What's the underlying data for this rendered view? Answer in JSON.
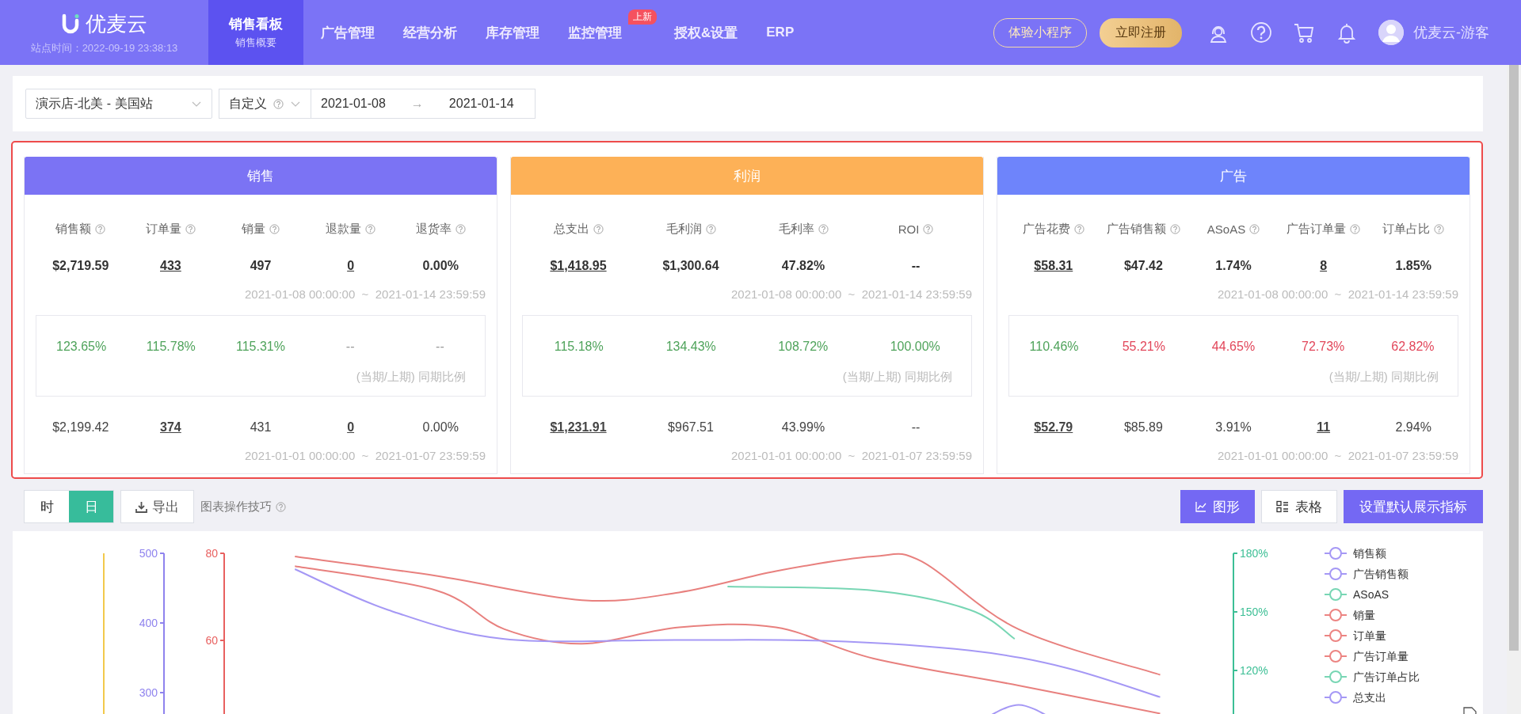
{
  "header": {
    "logo": "优麦云",
    "site_time": "站点时间：2022-09-19 23:38:13",
    "nav": [
      {
        "label": "销售看板",
        "sublabel": "销售概要",
        "selected": true
      },
      {
        "label": "广告管理",
        "selected": false
      },
      {
        "label": "经营分析",
        "selected": false
      },
      {
        "label": "库存管理",
        "selected": false
      },
      {
        "label": "监控管理",
        "badge": "上新",
        "selected": false
      },
      {
        "label": "授权&设置",
        "selected": false
      },
      {
        "label": "ERP",
        "selected": false
      }
    ],
    "mini_program_button": "体验小程序",
    "register_button": "立即注册",
    "user": "优麦云-游客"
  },
  "filters": {
    "store": "演示店-北美 - 美国站",
    "range_type": "自定义",
    "start_date": "2021-01-08",
    "separator": "→",
    "end_date": "2021-01-14"
  },
  "panels": [
    {
      "title": "销售",
      "color": "#7b73f4",
      "current_range": "2021-01-08 00:00:00  ~  2021-01-14 23:59:59",
      "ratio_note": "(当期/上期) 同期比例",
      "previous_range": "2021-01-01 00:00:00  ~  2021-01-07 23:59:59",
      "metrics": [
        {
          "label": "销售额",
          "current": "$2,719.59",
          "link": false,
          "ratio": "123.65%",
          "color": "#4fa35b",
          "previous": "$2,199.42"
        },
        {
          "label": "订单量",
          "current": "433",
          "link": true,
          "ratio": "115.78%",
          "color": "#4fa35b",
          "previous": "374"
        },
        {
          "label": "销量",
          "current": "497",
          "link": false,
          "ratio": "115.31%",
          "color": "#4fa35b",
          "previous": "431"
        },
        {
          "label": "退款量",
          "current": "0",
          "link": true,
          "ratio": "--",
          "color": "#999999",
          "previous": "0"
        },
        {
          "label": "退货率",
          "current": "0.00%",
          "link": false,
          "ratio": "--",
          "color": "#999999",
          "previous": "0.00%"
        }
      ]
    },
    {
      "title": "利润",
      "color": "#fdb157",
      "current_range": "2021-01-08 00:00:00  ~  2021-01-14 23:59:59",
      "ratio_note": "(当期/上期) 同期比例",
      "previous_range": "2021-01-01 00:00:00  ~  2021-01-07 23:59:59",
      "metrics": [
        {
          "label": "总支出",
          "current": "$1,418.95",
          "link": true,
          "ratio": "115.18%",
          "color": "#4fa35b",
          "previous": "$1,231.91"
        },
        {
          "label": "毛利润",
          "current": "$1,300.64",
          "link": false,
          "ratio": "134.43%",
          "color": "#4fa35b",
          "previous": "$967.51"
        },
        {
          "label": "毛利率",
          "current": "47.82%",
          "link": false,
          "ratio": "108.72%",
          "color": "#4fa35b",
          "previous": "43.99%"
        },
        {
          "label": "ROI",
          "current": "--",
          "link": false,
          "ratio": "100.00%",
          "color": "#4fa35b",
          "previous": "--"
        }
      ]
    },
    {
      "title": "广告",
      "color": "#6e84fb",
      "current_range": "2021-01-08 00:00:00  ~  2021-01-14 23:59:59",
      "ratio_note": "(当期/上期) 同期比例",
      "previous_range": "2021-01-01 00:00:00  ~  2021-01-07 23:59:59",
      "metrics": [
        {
          "label": "广告花费",
          "current": "$58.31",
          "link": true,
          "ratio": "110.46%",
          "color": "#4fa35b",
          "previous": "$52.79"
        },
        {
          "label": "广告销售额",
          "current": "$47.42",
          "link": false,
          "ratio": "55.21%",
          "color": "#e2465a",
          "previous": "$85.89"
        },
        {
          "label": "ASoAS",
          "current": "1.74%",
          "link": false,
          "ratio": "44.65%",
          "color": "#e2465a",
          "previous": "3.91%"
        },
        {
          "label": "广告订单量",
          "current": "8",
          "link": true,
          "ratio": "72.73%",
          "color": "#e2465a",
          "previous": "11"
        },
        {
          "label": "订单占比",
          "current": "1.85%",
          "link": false,
          "ratio": "62.82%",
          "color": "#e2465a",
          "previous": "2.94%"
        }
      ]
    }
  ],
  "toolbar": {
    "granularity": [
      {
        "label": "时",
        "selected": false
      },
      {
        "label": "日",
        "selected": true
      }
    ],
    "export_button": "导出",
    "tips": "图表操作技巧",
    "views": [
      {
        "label": "图形",
        "kind": "chart",
        "selected": true
      },
      {
        "label": "表格",
        "kind": "table",
        "selected": false
      }
    ],
    "default_metrics_button": "设置默认展示指标"
  },
  "chart": {
    "axes": [
      {
        "color": "#f2c94c"
      },
      {
        "color": "#8f83ee",
        "ticks": [
          "500",
          "400",
          "300"
        ]
      },
      {
        "color": "#e8605f",
        "ticks": [
          "80",
          "60"
        ]
      },
      {
        "color": "#3cbf95",
        "ticks": [
          "180%",
          "150%",
          "120%"
        ]
      }
    ],
    "legend": [
      {
        "label": "销售额",
        "color": "#a598f5"
      },
      {
        "label": "广告销售额",
        "color": "#a598f5"
      },
      {
        "label": "ASoAS",
        "color": "#78d6b4"
      },
      {
        "label": "销量",
        "color": "#ec8482"
      },
      {
        "label": "订单量",
        "color": "#ec8482"
      },
      {
        "label": "广告订单量",
        "color": "#ec8482"
      },
      {
        "label": "广告订单占比",
        "color": "#78d6b4"
      },
      {
        "label": "总支出",
        "color": "#a598f5"
      }
    ]
  }
}
